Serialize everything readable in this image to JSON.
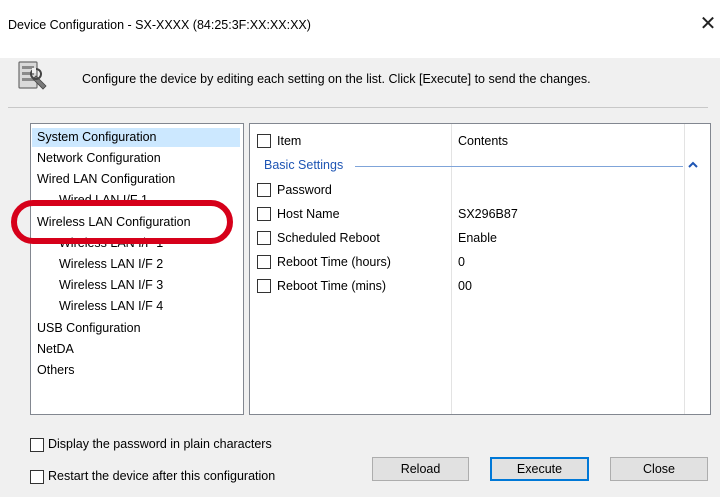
{
  "window": {
    "title": "Device Configuration - SX-XXXX (84:25:3F:XX:XX:XX)",
    "close_symbol": "✕"
  },
  "header": {
    "icon": "device-settings-icon",
    "instruction": "Configure the device by editing each setting on the list. Click [Execute] to send the changes."
  },
  "tree": {
    "items": [
      {
        "label": "System Configuration",
        "selected": true
      },
      {
        "label": "Network Configuration"
      },
      {
        "label": "Wired LAN Configuration"
      },
      {
        "label": "Wired LAN I/F 1"
      },
      {
        "label": "Wireless LAN Configuration"
      },
      {
        "label": "Wireless LAN I/F 1"
      },
      {
        "label": "Wireless LAN I/F 2"
      },
      {
        "label": "Wireless LAN I/F 3"
      },
      {
        "label": "Wireless LAN I/F 4"
      },
      {
        "label": "USB Configuration"
      },
      {
        "label": "NetDA"
      },
      {
        "label": "Others"
      }
    ]
  },
  "grid": {
    "header": {
      "item": "Item",
      "contents": "Contents"
    },
    "group": "Basic Settings",
    "rows": [
      {
        "item": "Password",
        "contents": ""
      },
      {
        "item": "Host Name",
        "contents": "SX296B87"
      },
      {
        "item": "Scheduled Reboot",
        "contents": "Enable"
      },
      {
        "item": "Reboot Time (hours)",
        "contents": "0"
      },
      {
        "item": "Reboot Time (mins)",
        "contents": "00"
      }
    ]
  },
  "options": {
    "display_password": "Display the password in plain characters",
    "restart_device": "Restart the device after this configuration"
  },
  "buttons": {
    "reload": "Reload",
    "execute": "Execute",
    "close": "Close"
  },
  "colors": {
    "highlight_ring": "#d6001a",
    "selection": "#cce8ff",
    "group_title": "#1e55b4",
    "default_button_border": "#0078d7"
  }
}
